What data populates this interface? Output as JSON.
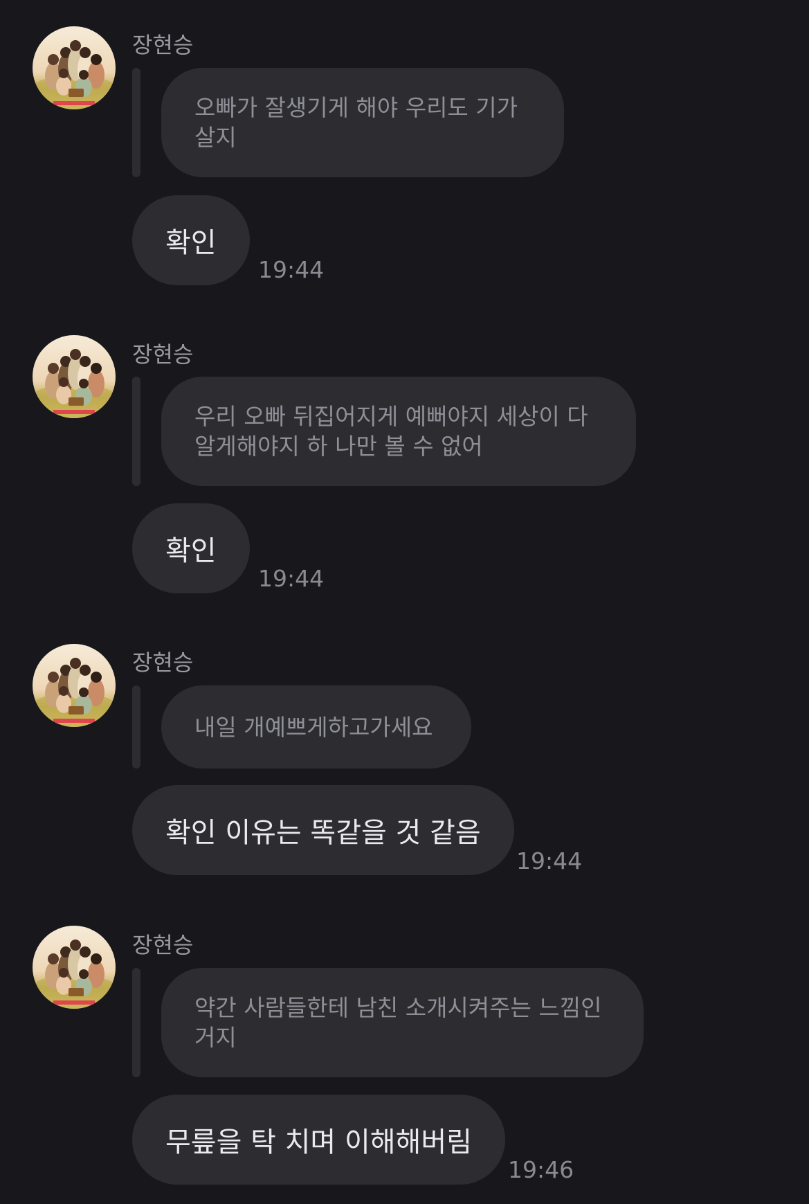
{
  "messages": [
    {
      "sender": "장현승",
      "quote": "오빠가 잘생기게 해야 우리도 기가 살지",
      "reply": "확인",
      "time": "19:44"
    },
    {
      "sender": "장현승",
      "quote": "우리 오빠 뒤집어지게 예뻐야지 세상이 다 알게해야지 하 나만 볼 수 없어",
      "reply": "확인",
      "time": "19:44"
    },
    {
      "sender": "장현승",
      "quote": "내일 개예쁘게하고가세요",
      "reply": "확인 이유는 똑같을 것 같음",
      "time": "19:44"
    },
    {
      "sender": "장현승",
      "quote": "약간 사람들한테 남친 소개시켜주는 느낌인 거지",
      "reply": "무릎을 탁 치며 이해해버림",
      "time": "19:46"
    }
  ],
  "icons": {
    "avatar": "group-photo-avatar-icon"
  },
  "colors": {
    "background": "#17171c",
    "bubble": "#2c2c31",
    "text": "#e9e9ee",
    "muted": "#8f8f97"
  }
}
